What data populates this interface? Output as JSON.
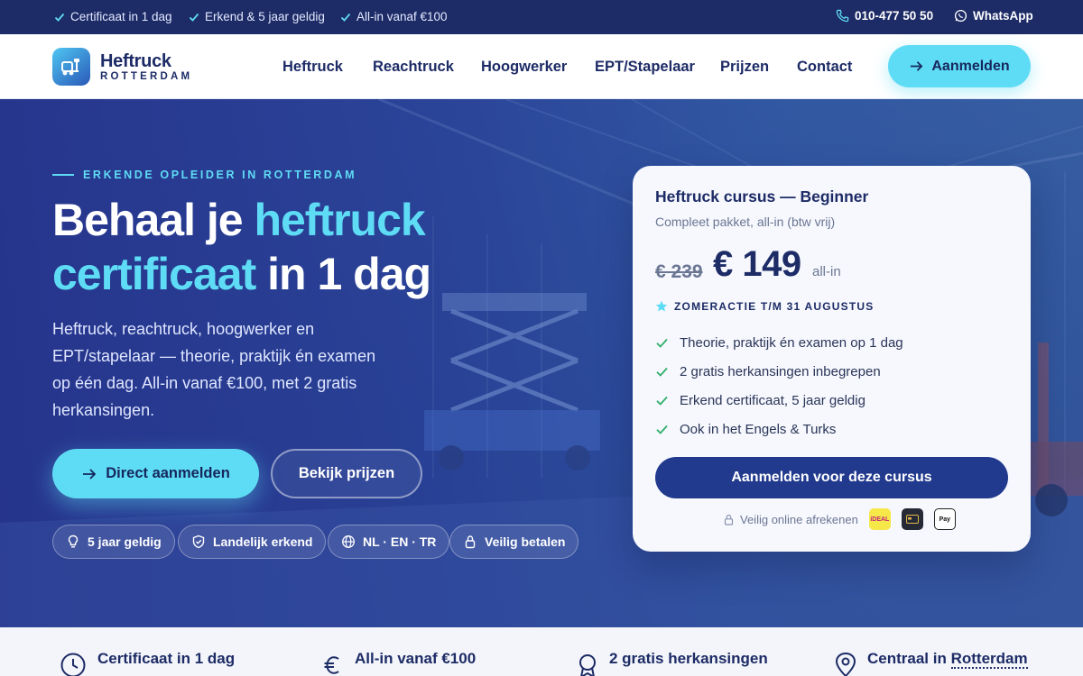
{
  "topbar": {
    "usps": [
      "Certificaat in 1 dag",
      "Erkend & 5 jaar geldig",
      "All-in vanaf €100"
    ],
    "phone": "010-477 50 50",
    "whatsapp": "WhatsApp"
  },
  "header": {
    "logo_title": "Heftruck",
    "logo_sub": "ROTTERDAM",
    "nav": [
      "Heftruck",
      "Reachtruck",
      "Hoogwerker",
      "EPT/Stapelaar",
      "Prijzen",
      "Contact"
    ],
    "cta": "Aanmelden"
  },
  "hero": {
    "eyebrow": "ERKENDE OPLEIDER IN ROTTERDAM",
    "title_part1": "Behaal je ",
    "title_highlight1": "heftruck",
    "title_highlight2": "certificaat",
    "title_part2": " in 1 dag",
    "lead": "Heftruck, reachtruck, hoogwerker en EPT/stapelaar — theorie, praktijk én examen op één dag. All-in vanaf €100, met 2 gratis herkansingen.",
    "primary_button": "Direct aanmelden",
    "secondary_button": "Bekijk prijzen",
    "pills": [
      "5 jaar geldig",
      "Landelijk erkend",
      "NL · EN · TR",
      "Veilig betalen"
    ]
  },
  "card": {
    "title": "Heftruck cursus — Beginner",
    "subtitle": "Compleet pakket, all-in (btw vrij)",
    "price_old": "€ 239",
    "price_new": "€ 149",
    "price_suffix": "all-in",
    "promo": "ZOMERACTIE T/M 31 AUGUSTUS",
    "features": [
      "Theorie, praktijk én examen op 1 dag",
      "2 gratis herkansingen inbegrepen",
      "Erkend certificaat, 5 jaar geldig",
      "Ook in het Engels & Turks"
    ],
    "button": "Aanmelden voor deze cursus",
    "secure_text": "Veilig online afrekenen",
    "payment_labels": [
      "iDEAL",
      "",
      "Pay"
    ]
  },
  "strip": {
    "items": [
      {
        "title": "Certificaat in 1 dag"
      },
      {
        "title": "All-in vanaf €100"
      },
      {
        "title": "2 gratis herkansingen"
      },
      {
        "title_part": "Centraal in ",
        "title_link": "Rotterdam"
      }
    ]
  },
  "colors": {
    "navy": "#1d2b66",
    "accent_cyan": "#5fdcf5",
    "card_button": "#223a8e",
    "check_green": "#2fae6a"
  }
}
